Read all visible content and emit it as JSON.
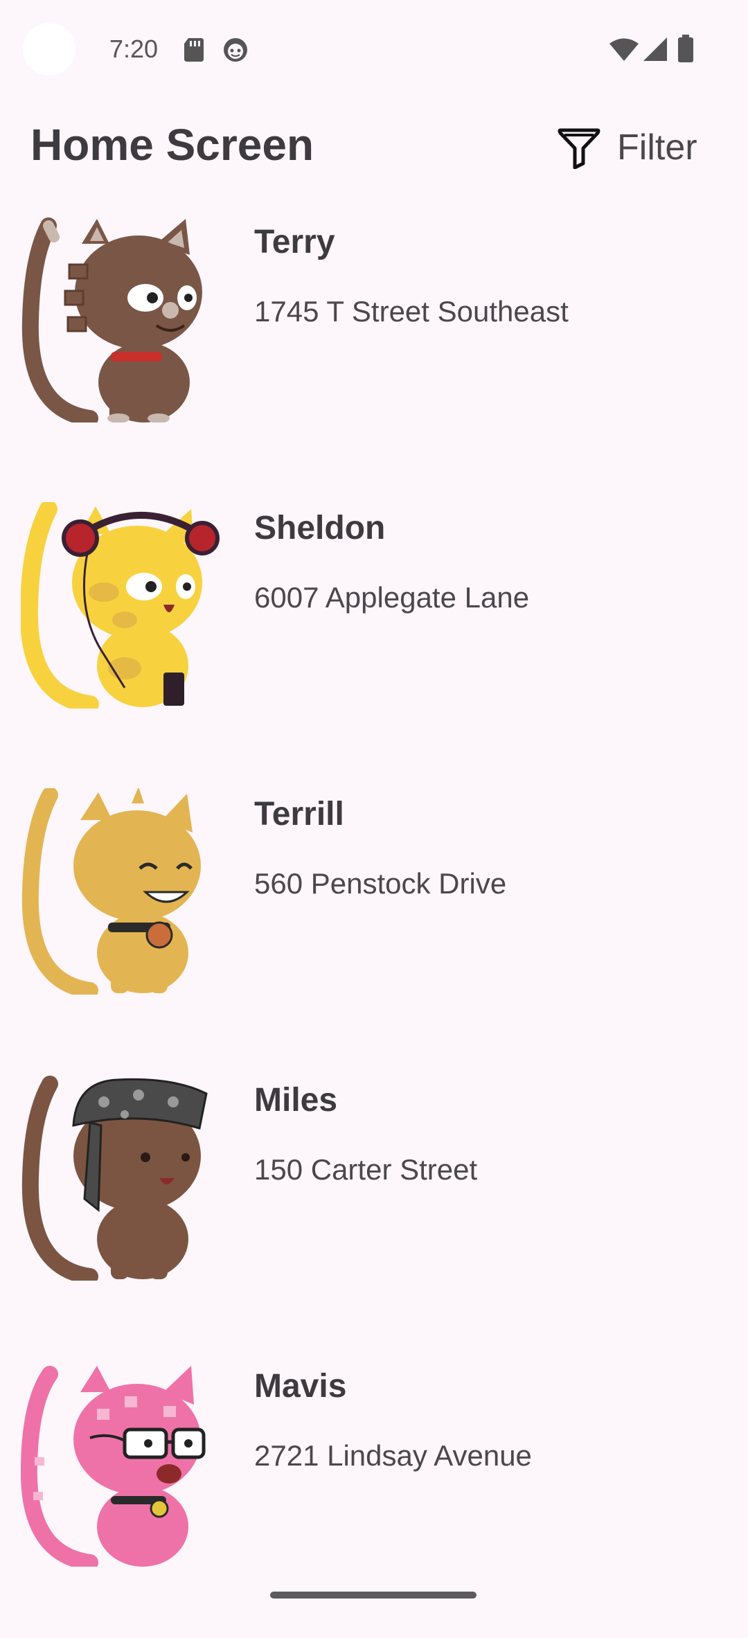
{
  "status_bar": {
    "time": "7:20",
    "left_icons": [
      "sd-card-icon",
      "notification-face-icon"
    ],
    "right_icons": [
      "wifi-icon",
      "signal-icon",
      "battery-icon"
    ]
  },
  "header": {
    "title": "Home Screen",
    "filter_label": "Filter",
    "filter_icon": "funnel-icon"
  },
  "cats": [
    {
      "name": "Terry",
      "address": "1745 T Street Southeast"
    },
    {
      "name": "Sheldon",
      "address": "6007 Applegate Lane"
    },
    {
      "name": "Terrill",
      "address": "560 Penstock Drive"
    },
    {
      "name": "Miles",
      "address": "150 Carter Street"
    },
    {
      "name": "Mavis",
      "address": "2721 Lindsay Avenue"
    }
  ],
  "colors": {
    "background": "#fdf6fb",
    "text": "#3d3a40",
    "cat_terry": "#7a5646",
    "cat_sheldon": "#f7d23e",
    "cat_terrill": "#e2b552",
    "cat_miles": "#7b5542",
    "cat_mavis": "#ee72a8"
  }
}
